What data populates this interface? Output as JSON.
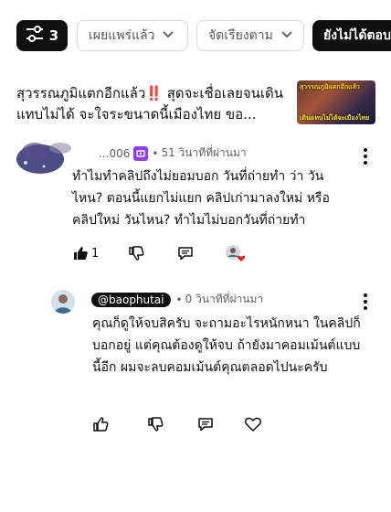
{
  "filters": {
    "active_count": "3",
    "published": "เผยแพร่แล้ว",
    "sort": "จัดเรียงตาม",
    "unreplied": "ยังไม่ได้ตอบ"
  },
  "video": {
    "title": "สุวรรณภูมิแตกอีกแล้ว‼️ สุดจะเชื่อเลยจนเดินแทบไม่ได้ จะใจระขนาดนี้เมืองไทย ขอ...",
    "thumb_text_top": "สุวรรณภูมิแตกอีกแล้ว",
    "thumb_text_bottom": "เดินแทบไม่ได้จะเมืองไทย"
  },
  "comment": {
    "author": "...006",
    "time": "51 วินาทีที่ผ่านมา",
    "text": "ทำไมทำคลิปถึงไม่ยอมบอก วันที่ถ่ายทำ ว่า วันไหน? ตอนนี้แยกไม่แยก คลิปเก่ามาลงใหม่ หรือคลิปใหม่ วันไหน? ทำไมไม่บอกวันที่ถ่ายทำ",
    "like_count": "1"
  },
  "reply": {
    "author": "@baophutai",
    "time": "0 วินาทีที่ผ่านมา",
    "text": "คุณก็ดูให้จบสิครับ จะถามอะไรหนักหนา ในคลิปก็บอกอยู่ แต่คุณต้องดูให้จบ ถ้ายังมาคอมเม้นต์แบบนี้อีก ผมจะลบคอมเม้นต์คุณตลอดไปนะครับ"
  },
  "meta_separator": "•"
}
